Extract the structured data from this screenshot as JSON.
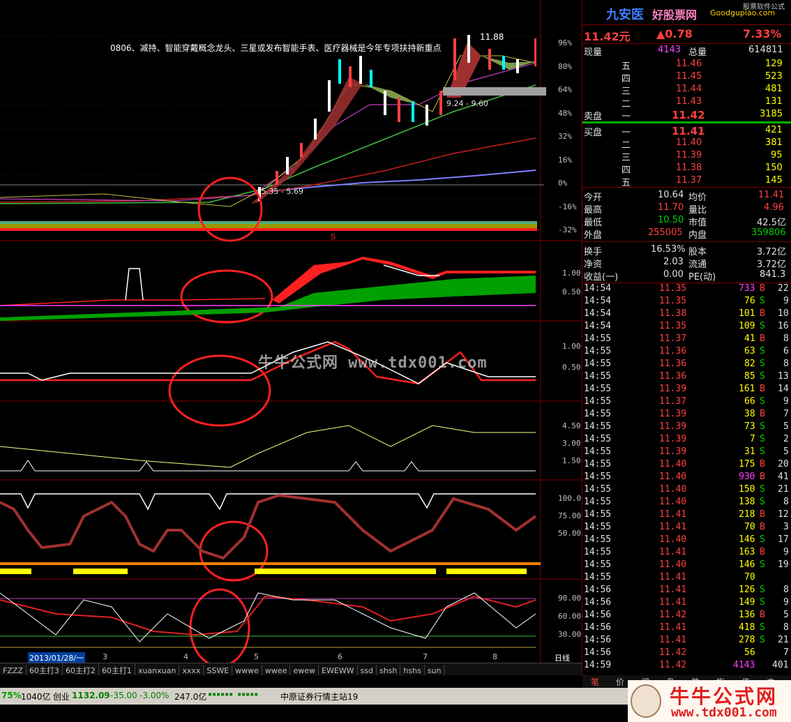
{
  "stock": {
    "name": "九安医",
    "site_banner": "好股票网",
    "site_banner2": "Goodgupiao.com",
    "corner_text": "股票软件公式",
    "price": "11.42元",
    "change": "▲0.78",
    "change_pct": "7.33%"
  },
  "quote": {
    "xianliang_label": "现量",
    "xianliang": "4143",
    "zongliang_label": "总量",
    "zongliang": "614811",
    "sell": [
      {
        "level": "五",
        "price": "11.46",
        "vol": "129"
      },
      {
        "level": "四",
        "price": "11.45",
        "vol": "523"
      },
      {
        "level": "三",
        "price": "11.44",
        "vol": "481"
      },
      {
        "level": "二",
        "price": "11.43",
        "vol": "131"
      },
      {
        "level": "一",
        "price": "11.42",
        "vol": "3185"
      }
    ],
    "sell_label": "卖盘",
    "buy_label": "买盘",
    "buy": [
      {
        "level": "一",
        "price": "11.41",
        "vol": "421"
      },
      {
        "level": "二",
        "price": "11.40",
        "vol": "381"
      },
      {
        "level": "三",
        "price": "11.39",
        "vol": "95"
      },
      {
        "level": "四",
        "price": "11.38",
        "vol": "150"
      },
      {
        "level": "五",
        "price": "11.37",
        "vol": "145"
      }
    ],
    "stats": [
      {
        "l1": "今开",
        "v1": "10.64",
        "c1": "white",
        "l2": "均价",
        "v2": "11.41",
        "c2": "red"
      },
      {
        "l1": "最高",
        "v1": "11.70",
        "c1": "red",
        "l2": "量比",
        "v2": "4.96",
        "c2": "red"
      },
      {
        "l1": "最低",
        "v1": "10.50",
        "c1": "green",
        "l2": "市值",
        "v2": "42.5亿",
        "c2": "white"
      },
      {
        "l1": "外盘",
        "v1": "255005",
        "c1": "red",
        "l2": "内盘",
        "v2": "359806",
        "c2": "green"
      }
    ],
    "stats2": [
      {
        "l1": "换手",
        "v1": "16.53%",
        "l2": "股本",
        "v2": "3.72亿"
      },
      {
        "l1": "净资",
        "v1": "2.03",
        "l2": "流通",
        "v2": "3.72亿"
      },
      {
        "l1": "收益(一)",
        "v1": "0.00",
        "l2": "PE(动)",
        "v2": "841.3"
      }
    ]
  },
  "trades": [
    {
      "t": "14:54",
      "p": "11.35",
      "v": "733",
      "vc": "purple",
      "bs": "B",
      "n": "22"
    },
    {
      "t": "14:54",
      "p": "11.35",
      "v": "76",
      "vc": "yellow",
      "bs": "S",
      "n": "9"
    },
    {
      "t": "14:54",
      "p": "11.38",
      "v": "101",
      "vc": "yellow",
      "bs": "B",
      "n": "10"
    },
    {
      "t": "14:54",
      "p": "11.35",
      "v": "109",
      "vc": "yellow",
      "bs": "S",
      "n": "16"
    },
    {
      "t": "14:55",
      "p": "11.37",
      "v": "41",
      "vc": "yellow",
      "bs": "B",
      "n": "8"
    },
    {
      "t": "14:55",
      "p": "11.36",
      "v": "63",
      "vc": "yellow",
      "bs": "S",
      "n": "6"
    },
    {
      "t": "14:55",
      "p": "11.36",
      "v": "82",
      "vc": "yellow",
      "bs": "S",
      "n": "8"
    },
    {
      "t": "14:55",
      "p": "11.36",
      "v": "85",
      "vc": "yellow",
      "bs": "S",
      "n": "13"
    },
    {
      "t": "14:55",
      "p": "11.39",
      "v": "161",
      "vc": "yellow",
      "bs": "B",
      "n": "14"
    },
    {
      "t": "14:55",
      "p": "11.37",
      "v": "66",
      "vc": "yellow",
      "bs": "S",
      "n": "9"
    },
    {
      "t": "14:55",
      "p": "11.39",
      "v": "38",
      "vc": "yellow",
      "bs": "B",
      "n": "7"
    },
    {
      "t": "14:55",
      "p": "11.39",
      "v": "73",
      "vc": "yellow",
      "bs": "S",
      "n": "5"
    },
    {
      "t": "14:55",
      "p": "11.39",
      "v": "7",
      "vc": "yellow",
      "bs": "S",
      "n": "2"
    },
    {
      "t": "14:55",
      "p": "11.39",
      "v": "31",
      "vc": "yellow",
      "bs": "S",
      "n": "5"
    },
    {
      "t": "14:55",
      "p": "11.40",
      "v": "175",
      "vc": "yellow",
      "bs": "B",
      "n": "20"
    },
    {
      "t": "14:55",
      "p": "11.40",
      "v": "930",
      "vc": "purple",
      "bs": "B",
      "n": "41"
    },
    {
      "t": "14:55",
      "p": "11.40",
      "v": "150",
      "vc": "yellow",
      "bs": "S",
      "n": "21"
    },
    {
      "t": "14:55",
      "p": "11.40",
      "v": "138",
      "vc": "yellow",
      "bs": "S",
      "n": "8"
    },
    {
      "t": "14:55",
      "p": "11.41",
      "v": "218",
      "vc": "yellow",
      "bs": "B",
      "n": "12"
    },
    {
      "t": "14:55",
      "p": "11.41",
      "v": "70",
      "vc": "yellow",
      "bs": "B",
      "n": "3"
    },
    {
      "t": "14:55",
      "p": "11.40",
      "v": "146",
      "vc": "yellow",
      "bs": "S",
      "n": "17"
    },
    {
      "t": "14:55",
      "p": "11.41",
      "v": "163",
      "vc": "yellow",
      "bs": "B",
      "n": "9"
    },
    {
      "t": "14:55",
      "p": "11.40",
      "v": "146",
      "vc": "yellow",
      "bs": "S",
      "n": "19"
    },
    {
      "t": "14:55",
      "p": "11.41",
      "v": "70",
      "vc": "yellow",
      "bs": "",
      "n": ""
    },
    {
      "t": "14:56",
      "p": "11.41",
      "v": "126",
      "vc": "yellow",
      "bs": "S",
      "n": "8"
    },
    {
      "t": "14:56",
      "p": "11.41",
      "v": "149",
      "vc": "yellow",
      "bs": "S",
      "n": "9"
    },
    {
      "t": "14:56",
      "p": "11.42",
      "v": "136",
      "vc": "yellow",
      "bs": "B",
      "n": "5"
    },
    {
      "t": "14:56",
      "p": "11.41",
      "v": "418",
      "vc": "yellow",
      "bs": "S",
      "n": "8"
    },
    {
      "t": "14:56",
      "p": "11.41",
      "v": "278",
      "vc": "yellow",
      "bs": "S",
      "n": "21"
    },
    {
      "t": "14:56",
      "p": "11.42",
      "v": "56",
      "vc": "yellow",
      "bs": "",
      "n": "7"
    },
    {
      "t": "14:59",
      "p": "11.42",
      "v": "4143",
      "vc": "purple",
      "bs": "",
      "n": "401"
    }
  ],
  "chart": {
    "annotation": "0806、减持、智能穿戴概念龙头、三星或发布智能手表、医疗器械是今年专项扶持新重点",
    "high_label": "11.88",
    "mid_label": "9.24 - 9.60",
    "low_label": "5.35 - 5.69",
    "s_marker": "S",
    "main_axis": [
      "96%",
      "80%",
      "64%",
      "48%",
      "32%",
      "16%",
      "0%",
      "-16%",
      "-32%"
    ],
    "p2_axis": [
      "1.00",
      "0.50"
    ],
    "p3_axis": [
      "1.00",
      "0.50"
    ],
    "p4_axis": [
      "4.50",
      "3.00",
      "1.50"
    ],
    "p5_axis": [
      "100.0",
      "75.00",
      "50.00"
    ],
    "p6_axis": [
      "90.00",
      "60.00",
      "30.00"
    ],
    "date_label": "2013/01/28/一",
    "month_labels": [
      "3",
      "4",
      "5",
      "6",
      "7",
      "8"
    ],
    "period": "日线",
    "watermark": "牛牛公式网 www.tdx001.com"
  },
  "tabs": [
    "FZZZ",
    "60主打3",
    "60主打2",
    "60主打1",
    "xuanxuan",
    "xxxx",
    "SSWE",
    "wwwe",
    "wwee",
    "ewew",
    "EWEWW",
    "ssd",
    "shsh",
    "hshs",
    "sun"
  ],
  "right_tabs": [
    "笔",
    "价",
    "细",
    "盘",
    "势",
    "指",
    "值",
    "主"
  ],
  "status": {
    "s1": "75%",
    "s2": "1040亿",
    "s3": "创业",
    "s4": "1132.09",
    "s5": "-35.00",
    "s6": "-3.00%",
    "s7": "247.0亿",
    "s8": "中原证券行情主站19"
  },
  "logo": {
    "text": "牛牛公式网",
    "url": "www.tdx001.com"
  },
  "colors": {
    "up": "#ff4040",
    "down": "#00d000",
    "grid": "#800000",
    "bg": "#000000"
  }
}
